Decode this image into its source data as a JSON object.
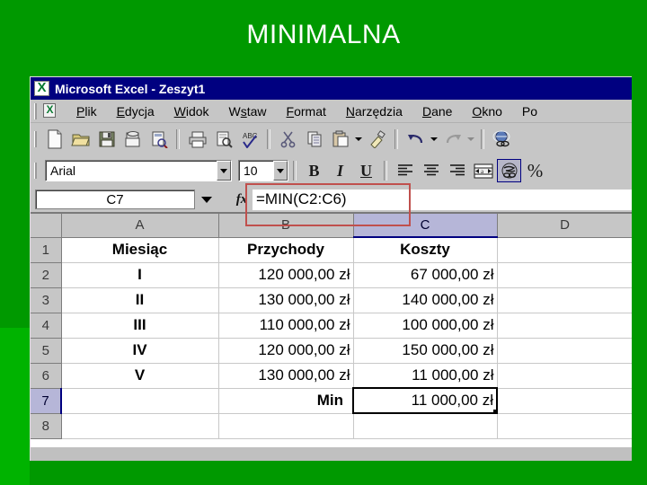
{
  "slide": {
    "title": "MINIMALNA",
    "background_color": "#009900",
    "title_color": "#ffffff"
  },
  "window": {
    "title": "Microsoft Excel - Zeszyt1",
    "titlebar_color": "#000080",
    "app_icon": "excel-logo-icon"
  },
  "menubar": {
    "doc_icon": "excel-document-icon",
    "items": [
      {
        "label": "Plik",
        "accel": "P"
      },
      {
        "label": "Edycja",
        "accel": "E"
      },
      {
        "label": "Widok",
        "accel": "W"
      },
      {
        "label": "Wstaw",
        "accel": "s"
      },
      {
        "label": "Format",
        "accel": "F"
      },
      {
        "label": "Narzędzia",
        "accel": "N"
      },
      {
        "label": "Dane",
        "accel": "D"
      },
      {
        "label": "Okno",
        "accel": "O"
      },
      {
        "label": "Po",
        "accel": ""
      }
    ]
  },
  "standard_toolbar": {
    "buttons": [
      {
        "name": "new-document-icon",
        "tooltip": "Nowy"
      },
      {
        "name": "open-folder-icon",
        "tooltip": "Otwórz"
      },
      {
        "name": "save-disk-icon",
        "tooltip": "Zapisz"
      },
      {
        "name": "mail-icon",
        "tooltip": "Poczta"
      },
      {
        "name": "search-document-icon",
        "tooltip": "Wyszukaj"
      },
      {
        "name": "print-icon",
        "tooltip": "Drukuj"
      },
      {
        "name": "print-preview-icon",
        "tooltip": "Podgląd wydruku"
      },
      {
        "name": "spelling-abc-icon",
        "tooltip": "Pisownia"
      },
      {
        "name": "cut-scissors-icon",
        "tooltip": "Wytnij"
      },
      {
        "name": "copy-icon",
        "tooltip": "Kopiuj"
      },
      {
        "name": "paste-clipboard-icon",
        "tooltip": "Wklej"
      },
      {
        "name": "format-painter-icon",
        "tooltip": "Malarz formatów"
      },
      {
        "name": "undo-arrow-icon",
        "tooltip": "Cofnij"
      },
      {
        "name": "redo-arrow-icon",
        "tooltip": "Ponów"
      },
      {
        "name": "hyperlink-globe-icon",
        "tooltip": "Hiperłącze"
      }
    ]
  },
  "formatting_toolbar": {
    "font_name": "Arial",
    "font_size": "10",
    "bold_label": "B",
    "italic_label": "I",
    "underline_label": "U",
    "align_left": "align-left-icon",
    "align_center": "align-center-icon",
    "align_right": "align-right-icon",
    "merge_center": "merge-cells-icon",
    "currency_label": "currency-icon",
    "currency_active": true,
    "percent_label": "%"
  },
  "formula_bar": {
    "name_box": "C7",
    "fx_label": "fx",
    "formula": "=MIN(C2:C6)",
    "highlight_color": "#c0504d"
  },
  "sheet": {
    "columns": [
      "A",
      "B",
      "C",
      "D"
    ],
    "selected_column": "C",
    "selected_row": "7",
    "active_cell": "C7",
    "row_headers": [
      "1",
      "2",
      "3",
      "4",
      "5",
      "6",
      "7",
      "8"
    ],
    "rows": [
      {
        "header": "1",
        "cells": [
          "Miesiąc",
          "Przychody",
          "Koszty",
          ""
        ],
        "style": "hdr"
      },
      {
        "header": "2",
        "cells": [
          "I",
          "120 000,00 zł",
          "67 000,00 zł",
          ""
        ],
        "style": "data"
      },
      {
        "header": "3",
        "cells": [
          "II",
          "130 000,00 zł",
          "140 000,00 zł",
          ""
        ],
        "style": "data"
      },
      {
        "header": "4",
        "cells": [
          "III",
          "110 000,00 zł",
          "100 000,00 zł",
          ""
        ],
        "style": "data"
      },
      {
        "header": "5",
        "cells": [
          "IV",
          "120 000,00 zł",
          "150 000,00 zł",
          ""
        ],
        "style": "data"
      },
      {
        "header": "6",
        "cells": [
          "V",
          "130 000,00 zł",
          "11 000,00 zł",
          ""
        ],
        "style": "data"
      },
      {
        "header": "7",
        "cells": [
          "",
          "Min",
          "11 000,00 zł",
          ""
        ],
        "style": "result"
      },
      {
        "header": "8",
        "cells": [
          "",
          "",
          "",
          ""
        ],
        "style": "empty"
      }
    ]
  }
}
